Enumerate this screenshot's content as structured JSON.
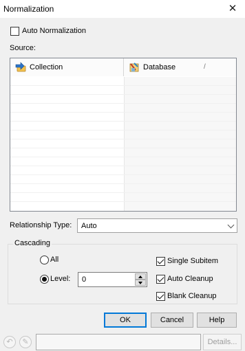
{
  "window": {
    "title": "Normalization",
    "close_glyph": "✕"
  },
  "auto_normalization": {
    "label": "Auto Normalization",
    "checked": false
  },
  "source": {
    "label": "Source:",
    "columns": [
      {
        "label": "Collection",
        "icon": "collection-arrow-icon"
      },
      {
        "label": "Database",
        "icon": "database-icon",
        "sort_glyph": "/"
      }
    ]
  },
  "relationship_type": {
    "label": "Relationship Type:",
    "value": "Auto"
  },
  "cascading": {
    "legend": "Cascading",
    "all_label": "All",
    "level_label": "Level:",
    "level_value": "0",
    "all_selected": false,
    "level_selected": true,
    "single_subitem": {
      "label": "Single Subitem",
      "checked": true
    },
    "auto_cleanup": {
      "label": "Auto Cleanup",
      "checked": true
    },
    "blank_cleanup": {
      "label": "Blank Cleanup",
      "checked": true
    }
  },
  "buttons": {
    "ok": "OK",
    "cancel": "Cancel",
    "help": "Help"
  },
  "statusbar": {
    "undo_icon": "undo-icon",
    "edit_icon": "pencil-icon",
    "details_label": "Details..."
  },
  "colors": {
    "accent": "#0078d7",
    "window_bg": "#f0f0f0"
  }
}
